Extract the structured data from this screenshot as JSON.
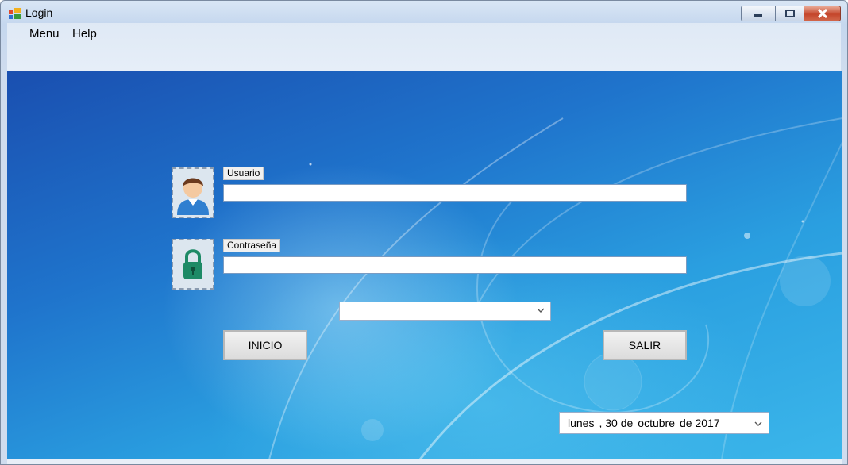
{
  "window": {
    "title": "Login",
    "controls": {
      "minimize": "minimize",
      "maximize": "maximize",
      "close": "close"
    }
  },
  "menu": {
    "items": [
      "Menu",
      "Help"
    ]
  },
  "form": {
    "username_label": "Usuario",
    "username_value": "",
    "password_label": "Contraseña",
    "password_value": "",
    "combo_value": "",
    "login_button": "INICIO",
    "exit_button": "SALIR"
  },
  "date_picker": {
    "day": "lunes",
    "day_num": ", 30 de",
    "month": "octubre",
    "year": "de 2017"
  },
  "icons": {
    "app": "form-icon",
    "user": "user-avatar-icon",
    "lock": "lock-icon",
    "dropdown": "chevron-down-icon"
  },
  "colors": {
    "background_top": "#1a4fb0",
    "background_bottom": "#3bb6ea",
    "close_button": "#c4462b",
    "lock_green": "#1d8a66"
  }
}
